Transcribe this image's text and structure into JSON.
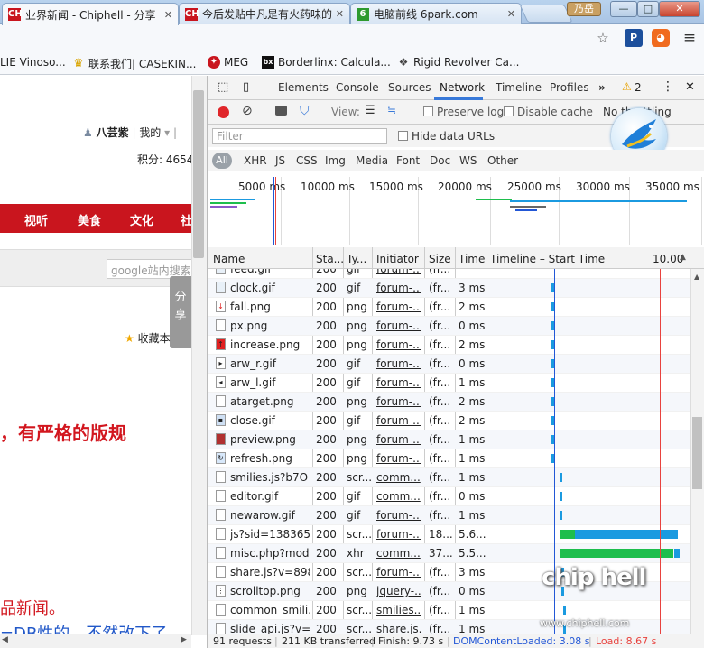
{
  "browser": {
    "tabs": [
      {
        "title": "业界新闻 - Chiphell - 分享",
        "favicon": "CH",
        "active": true
      },
      {
        "title": "今后发贴中凡是有火药味的",
        "favicon": "CH",
        "active": false
      },
      {
        "title": "电脑前线 6park.com",
        "favicon": "6",
        "active": false
      }
    ],
    "user_badge": "乃岳",
    "window_controls": {
      "minimize": "—",
      "maximize": "□",
      "close": "✕"
    },
    "bookmarks": [
      {
        "label": "LIE Vinoso...",
        "icon": ""
      },
      {
        "label": "联系我们| CASEKIN...",
        "icon": "crown-icon"
      },
      {
        "label": "MEG",
        "icon": "msi-icon"
      },
      {
        "label": "Borderlinx: Calcula...",
        "icon": "bx-icon"
      },
      {
        "label": "Rigid Revolver Ca...",
        "icon": "folder-icon"
      }
    ]
  },
  "page": {
    "user_name": "八芸紫",
    "user_link": "我的",
    "points": "积分: 4654",
    "nav": [
      "视听",
      "美食",
      "文化",
      "社"
    ],
    "search_placeholder": "google站内搜索",
    "share_tab": "分享",
    "favorite": "收藏本",
    "headline": "，有严格的版规",
    "subline": "品新闻。",
    "subline2": "=DB性的，不然改下了"
  },
  "devtools": {
    "panel_tabs": [
      "Elements",
      "Console",
      "Sources",
      "Network",
      "Timeline",
      "Profiles"
    ],
    "active_tab": "Network",
    "more_tabs": "»",
    "warnings": "2",
    "toolbar": {
      "view_label": "View:",
      "preserve_log": "Preserve log",
      "disable_cache": "Disable cache",
      "throttle": "No throttling"
    },
    "filter": {
      "placeholder": "Filter",
      "hide_data_urls": "Hide data URLs"
    },
    "types": [
      "All",
      "XHR",
      "JS",
      "CSS",
      "Img",
      "Media",
      "Font",
      "Doc",
      "WS",
      "Other"
    ],
    "overview_ticks": [
      "5000 ms",
      "10000 ms",
      "15000 ms",
      "20000 ms",
      "25000 ms",
      "30000 ms",
      "35000 ms"
    ],
    "columns": [
      "Name",
      "Sta...",
      "Ty...",
      "Initiator",
      "Size",
      "Time",
      "Timeline – Start Time",
      "10.00"
    ],
    "rows": [
      {
        "name": "feed.gif",
        "status": "200",
        "type": "gif",
        "initiator": "forum-...",
        "size": "(fr...",
        "time": "",
        "icon": "gif",
        "wf_start": 0.0,
        "wf_width": 0.0
      },
      {
        "name": "clock.gif",
        "status": "200",
        "type": "gif",
        "initiator": "forum-...",
        "size": "(fr...",
        "time": "3 ms",
        "icon": "gif",
        "wf_start": 0.31,
        "wf_width": 0.01
      },
      {
        "name": "fall.png",
        "status": "200",
        "type": "png",
        "initiator": "forum-...",
        "size": "(fr...",
        "time": "2 ms",
        "icon": "red-arrow",
        "wf_start": 0.31,
        "wf_width": 0.01
      },
      {
        "name": "px.png",
        "status": "200",
        "type": "png",
        "initiator": "forum-...",
        "size": "(fr...",
        "time": "0 ms",
        "icon": "blank",
        "wf_start": 0.31,
        "wf_width": 0.01
      },
      {
        "name": "increase.png",
        "status": "200",
        "type": "png",
        "initiator": "forum-...",
        "size": "(fr...",
        "time": "2 ms",
        "icon": "red-up",
        "wf_start": 0.31,
        "wf_width": 0.01
      },
      {
        "name": "arw_r.gif",
        "status": "200",
        "type": "gif",
        "initiator": "forum-...",
        "size": "(fr...",
        "time": "0 ms",
        "icon": "arrow-right",
        "wf_start": 0.31,
        "wf_width": 0.01
      },
      {
        "name": "arw_l.gif",
        "status": "200",
        "type": "gif",
        "initiator": "forum-...",
        "size": "(fr...",
        "time": "1 ms",
        "icon": "arrow-left",
        "wf_start": 0.31,
        "wf_width": 0.01
      },
      {
        "name": "atarget.png",
        "status": "200",
        "type": "png",
        "initiator": "forum-...",
        "size": "(fr...",
        "time": "2 ms",
        "icon": "blank",
        "wf_start": 0.31,
        "wf_width": 0.01
      },
      {
        "name": "close.gif",
        "status": "200",
        "type": "gif",
        "initiator": "forum-...",
        "size": "(fr...",
        "time": "2 ms",
        "icon": "lock",
        "wf_start": 0.31,
        "wf_width": 0.01
      },
      {
        "name": "preview.png",
        "status": "200",
        "type": "png",
        "initiator": "forum-...",
        "size": "(fr...",
        "time": "1 ms",
        "icon": "preview",
        "wf_start": 0.31,
        "wf_width": 0.01
      },
      {
        "name": "refresh.png",
        "status": "200",
        "type": "png",
        "initiator": "forum-...",
        "size": "(fr...",
        "time": "1 ms",
        "icon": "refresh",
        "wf_start": 0.31,
        "wf_width": 0.01
      },
      {
        "name": "smilies.js?b7O",
        "status": "200",
        "type": "scr...",
        "initiator": "comm...",
        "size": "(fr...",
        "time": "1 ms",
        "icon": "blank",
        "wf_start": 0.35,
        "wf_width": 0.01
      },
      {
        "name": "editor.gif",
        "status": "200",
        "type": "gif",
        "initiator": "comm...",
        "size": "(fr...",
        "time": "0 ms",
        "icon": "blank",
        "wf_start": 0.35,
        "wf_width": 0.01
      },
      {
        "name": "newarow.gif",
        "status": "200",
        "type": "gif",
        "initiator": "forum-...",
        "size": "(fr...",
        "time": "1 ms",
        "icon": "blank",
        "wf_start": 0.35,
        "wf_width": 0.01
      },
      {
        "name": "js?sid=138365...",
        "status": "200",
        "type": "scr...",
        "initiator": "forum-...",
        "size": "18...",
        "time": "5.6...",
        "icon": "blank",
        "wf_start": 0.355,
        "wf_width": 0.59,
        "wf_split": 0.12
      },
      {
        "name": "misc.php?mod...",
        "status": "200",
        "type": "xhr",
        "initiator": "comm...",
        "size": "37...",
        "time": "5.5...",
        "icon": "blank",
        "wf_start": 0.355,
        "wf_width": 0.6,
        "wf_split": 0.95
      },
      {
        "name": "share.js?v=898...",
        "status": "200",
        "type": "scr...",
        "initiator": "forum-...",
        "size": "(fr...",
        "time": "3 ms",
        "icon": "blank",
        "wf_start": 0.36,
        "wf_width": 0.01
      },
      {
        "name": "scrolltop.png",
        "status": "200",
        "type": "png",
        "initiator": "jquery-...",
        "size": "(fr...",
        "time": "0 ms",
        "icon": "dots",
        "wf_start": 0.36,
        "wf_width": 0.01
      },
      {
        "name": "common_smili...",
        "status": "200",
        "type": "scr...",
        "initiator": "smilies...",
        "size": "(fr...",
        "time": "1 ms",
        "icon": "blank",
        "wf_start": 0.37,
        "wf_width": 0.01
      },
      {
        "name": "slide_api.js?v=...",
        "status": "200",
        "type": "scr...",
        "initiator": "share.js...",
        "size": "(fr...",
        "time": "1 ms",
        "icon": "blank",
        "wf_start": 0.37,
        "wf_width": 0.01
      }
    ],
    "status": {
      "requests": "91 requests",
      "transferred": "211 KB transferred",
      "finish": "Finish: 9.73 s",
      "dcl": "DOMContentLoaded: 3.08 s",
      "load": "Load: 8.67 s"
    },
    "colors": {
      "waiting": "#1ebe4d",
      "receiving": "#1b9ae0",
      "dcl": "#2257d6",
      "load": "#e8423e",
      "accent": "#3879d9"
    }
  },
  "watermark": {
    "logo": "chip hell",
    "url": "www.chiphell.com"
  }
}
